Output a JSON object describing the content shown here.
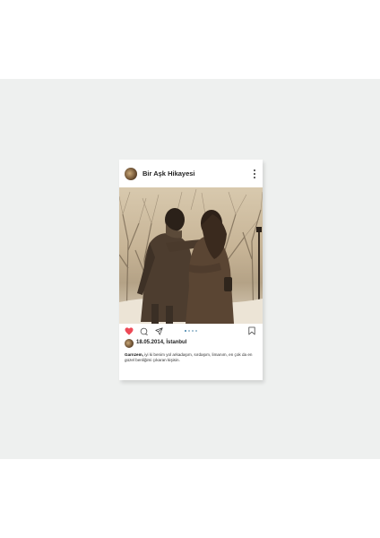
{
  "post": {
    "profile_name": "Bir Aşk Hikayesi",
    "date_location": "18.05.2014, İstanbul",
    "caption_author": "Garnzem,",
    "caption_text": " iyi ki benim yol arkadaşım, sırdaşım, limanım, en çok da en güzel benliğimi çıkaran kişisin.",
    "liked": true,
    "carousel_dots": 4,
    "carousel_active_index": 0
  },
  "icons": {
    "like": "heart-icon",
    "comment": "comment-icon",
    "share": "share-icon",
    "save": "bookmark-icon",
    "more": "more-icon"
  },
  "colors": {
    "heart": "#ed4956",
    "carousel_dot": "#8fb3c9",
    "carousel_dot_active": "#3a7ea8",
    "backdrop": "#eef0ef"
  }
}
